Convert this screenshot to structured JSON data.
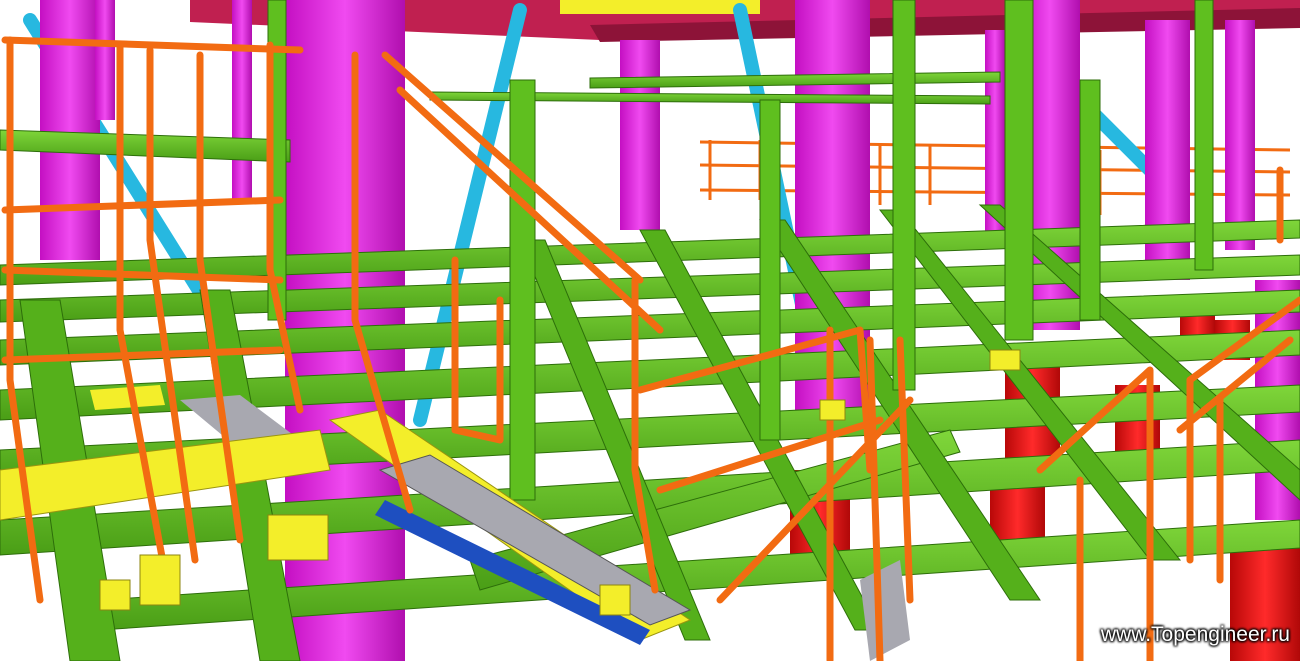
{
  "watermark": {
    "text": "www.Topengineer.ru"
  },
  "palette": {
    "beam": "#5fbf1f",
    "beam_dark": "#3f8f10",
    "column": "#e21fe0",
    "column_dark": "#a80fa6",
    "railing": "#f26b12",
    "brace": "#27b8e0",
    "stair": "#f3ee2a",
    "base_column": "#e01010",
    "top_beam": "#c02050",
    "grating": "#1e4fc0",
    "steel": "#a8a8b0"
  }
}
